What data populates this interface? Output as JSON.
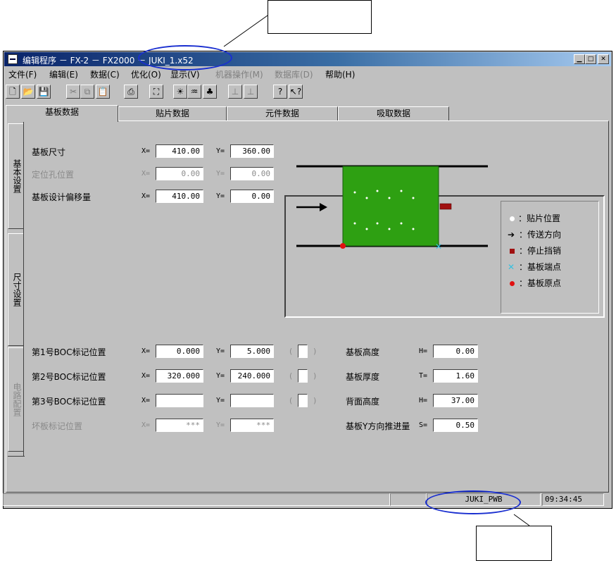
{
  "window": {
    "title": "编辑程序 － FX-2 － FX2000 － JUKI_1.x52",
    "controls": [
      "minimize-icon",
      "maximize-icon",
      "close-icon"
    ]
  },
  "menu": [
    {
      "label": "文件(F)",
      "enabled": true
    },
    {
      "label": "编辑(E)",
      "enabled": true
    },
    {
      "label": "数据(C)",
      "enabled": true
    },
    {
      "label": "优化(O)",
      "enabled": true
    },
    {
      "label": "显示(V)",
      "enabled": true
    },
    {
      "label": "机器操作(M)",
      "enabled": false
    },
    {
      "label": "数据库(D)",
      "enabled": false
    },
    {
      "label": "帮助(H)",
      "enabled": true
    }
  ],
  "toolbar": {
    "buttons": [
      {
        "icon": "new-file-icon",
        "glyph": "🗋",
        "enabled": true
      },
      {
        "icon": "open-folder-icon",
        "glyph": "📂",
        "enabled": true
      },
      {
        "icon": "save-icon",
        "glyph": "💾",
        "enabled": true
      },
      {
        "icon": "cut-icon",
        "glyph": "✂",
        "enabled": false
      },
      {
        "icon": "copy-icon",
        "glyph": "⧉",
        "enabled": false
      },
      {
        "icon": "paste-icon",
        "glyph": "📋",
        "enabled": false
      },
      {
        "icon": "print-icon",
        "glyph": "⎙",
        "enabled": true
      },
      {
        "icon": "binoculars-icon",
        "glyph": "⛶",
        "enabled": true
      },
      {
        "icon": "lightbulb-icon",
        "glyph": "☀",
        "enabled": true
      },
      {
        "icon": "nozzle-icon",
        "glyph": "♒",
        "enabled": true
      },
      {
        "icon": "components-icon",
        "glyph": "♣",
        "enabled": true
      },
      {
        "icon": "align-left-icon",
        "glyph": "⊥",
        "enabled": false
      },
      {
        "icon": "align-right-icon",
        "glyph": "⊥",
        "enabled": false
      },
      {
        "icon": "help-icon",
        "glyph": "?",
        "enabled": true
      },
      {
        "icon": "context-help-icon",
        "glyph": "↖?",
        "enabled": true
      }
    ]
  },
  "tabs": [
    {
      "label": "基板数据",
      "active": true
    },
    {
      "label": "贴片数据",
      "active": false
    },
    {
      "label": "元件数据",
      "active": false
    },
    {
      "label": "吸取数据",
      "active": false
    }
  ],
  "side_tabs": [
    {
      "label": "基本设置",
      "enabled": true
    },
    {
      "label": "尺寸设置",
      "enabled": true
    },
    {
      "label": "电路配置",
      "enabled": false
    }
  ],
  "board": {
    "size": {
      "label": "基板尺寸",
      "x_prefix": "X=",
      "x": "410.00",
      "y_prefix": "Y=",
      "y": "360.00",
      "enabled": true
    },
    "locating_hole": {
      "label": "定位孔位置",
      "x_prefix": "X=",
      "x": "0.00",
      "y_prefix": "Y=",
      "y": "0.00",
      "enabled": false
    },
    "design_offset": {
      "label": "基板设计偏移量",
      "x_prefix": "X=",
      "x": "410.00",
      "y_prefix": "Y=",
      "y": "0.00",
      "enabled": true
    }
  },
  "legend": [
    {
      "icon": "placement-dot-icon",
      "label": "：贴片位置"
    },
    {
      "icon": "arrow-right-icon",
      "label": "：传送方向"
    },
    {
      "icon": "stopper-icon",
      "label": "：停止挡销"
    },
    {
      "icon": "board-corner-icon",
      "label": "：基板端点"
    },
    {
      "icon": "board-origin-icon",
      "label": "：基板原点"
    }
  ],
  "colors": {
    "board": "#2ea012",
    "title_start": "#0a246a",
    "annotation": "#1a2fd0",
    "stopper": "#a01010",
    "corner": "#36c0e0",
    "origin": "#e01010"
  },
  "marks": [
    {
      "label": "第1号BOC标记位置",
      "x_prefix": "X=",
      "x": "0.000",
      "y_prefix": "Y=",
      "y": "5.000",
      "enabled": true
    },
    {
      "label": "第2号BOC标记位置",
      "x_prefix": "X=",
      "x": "320.000",
      "y_prefix": "Y=",
      "y": "240.000",
      "enabled": true
    },
    {
      "label": "第3号BOC标记位置",
      "x_prefix": "X=",
      "x": "",
      "y_prefix": "Y=",
      "y": "",
      "enabled": true
    },
    {
      "label": "坏板标记位置",
      "x_prefix": "X=",
      "x": "***",
      "y_prefix": "Y=",
      "y": "***",
      "enabled": false
    }
  ],
  "right_params": [
    {
      "label": "基板高度",
      "prefix": "H=",
      "value": "0.00"
    },
    {
      "label": "基板厚度",
      "prefix": "T=",
      "value": "1.60"
    },
    {
      "label": "背面高度",
      "prefix": "H=",
      "value": "37.00"
    },
    {
      "label": "基板Y方向推进量",
      "prefix": "S=",
      "value": "0.50"
    }
  ],
  "status": {
    "db_name": "JUKI_PWB",
    "time": "09:34:45"
  }
}
